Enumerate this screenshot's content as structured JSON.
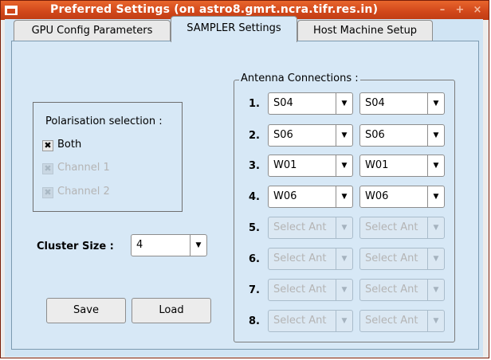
{
  "window": {
    "title": "Preferred Settings (on astro8.gmrt.ncra.tifr.res.in)",
    "buttons": {
      "minimize": "–",
      "maximize": "+",
      "close": "×"
    }
  },
  "tabs": [
    {
      "label": "GPU Config Parameters",
      "active": false
    },
    {
      "label": "SAMPLER Settings",
      "active": true
    },
    {
      "label": "Host Machine Setup",
      "active": false
    }
  ],
  "polarisation": {
    "title": "Polarisation selection :",
    "options": [
      {
        "label": "Both",
        "checked": true,
        "enabled": true
      },
      {
        "label": "Channel 1",
        "checked": true,
        "enabled": false
      },
      {
        "label": "Channel 2",
        "checked": true,
        "enabled": false
      }
    ]
  },
  "cluster": {
    "label": "Cluster Size :",
    "value": "4"
  },
  "buttons": {
    "save": "Save",
    "load": "Load"
  },
  "antenna": {
    "title": "Antenna Connections :",
    "rows": [
      {
        "num": "1.",
        "a": "S04",
        "b": "S04",
        "enabled": true
      },
      {
        "num": "2.",
        "a": "S06",
        "b": "S06",
        "enabled": true
      },
      {
        "num": "3.",
        "a": "W01",
        "b": "W01",
        "enabled": true
      },
      {
        "num": "4.",
        "a": "W06",
        "b": "W06",
        "enabled": true
      },
      {
        "num": "5.",
        "a": "Select Ant",
        "b": "Select Ant",
        "enabled": false
      },
      {
        "num": "6.",
        "a": "Select Ant",
        "b": "Select Ant",
        "enabled": false
      },
      {
        "num": "7.",
        "a": "Select Ant",
        "b": "Select Ant",
        "enabled": false
      },
      {
        "num": "8.",
        "a": "Select Ant",
        "b": "Select Ant",
        "enabled": false
      }
    ]
  },
  "icons": {
    "window": "window-icon",
    "dropdown": "chevron-down-icon",
    "check": "checkmark-icon"
  }
}
